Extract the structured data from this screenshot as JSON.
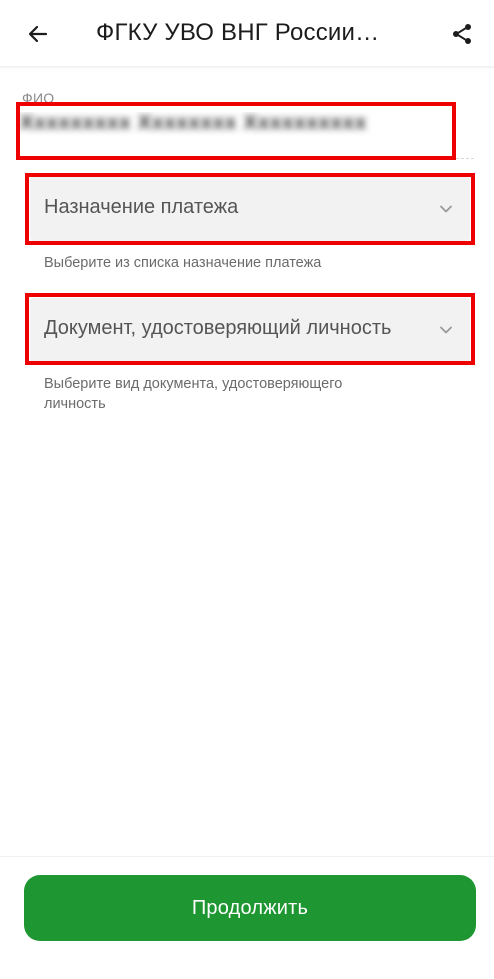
{
  "header": {
    "title": "ФГКУ УВО ВНГ России…",
    "back_icon": "arrow-left-icon",
    "share_icon": "share-icon"
  },
  "form": {
    "fio": {
      "label": "ФИО",
      "value": "Xxxxxxxxx Xxxxxxxx Xxxxxxxxxx"
    },
    "payment_purpose": {
      "placeholder": "Назначение платежа",
      "hint": "Выберите из списка назначение платежа",
      "icon": "chevron-down-icon"
    },
    "identity_document": {
      "placeholder": "Документ, удостоверяющий личность",
      "hint": "Выберите вид документа, удостоверяющего личность",
      "icon": "chevron-down-icon"
    }
  },
  "footer": {
    "continue_label": "Продолжить"
  },
  "colors": {
    "accent": "#1e9631",
    "highlight": "#ee0000",
    "field_bg": "#f2f2f2"
  }
}
